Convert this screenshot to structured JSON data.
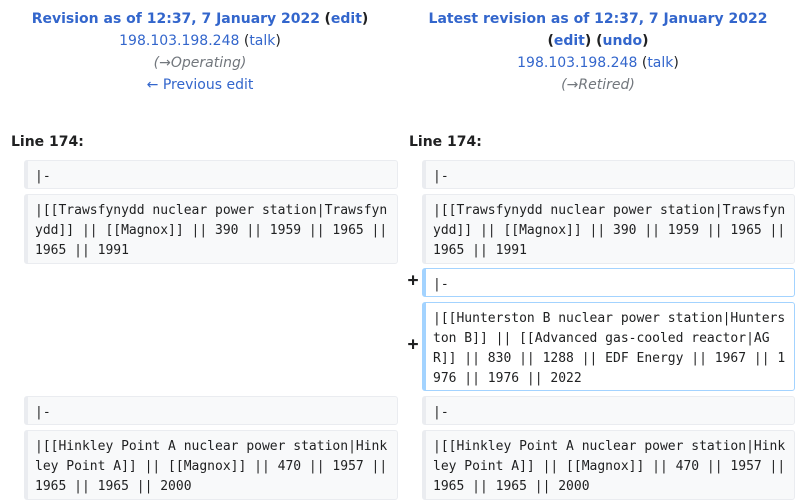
{
  "left": {
    "revision_label": "Revision as of 12:37, 7 January 2022",
    "edit_label": "edit",
    "user": "198.103.198.248",
    "talk_label": "talk",
    "summary_arrow": "→",
    "summary_text": "Operating",
    "prev_edit_label": "← Previous edit",
    "line_label": "Line 174:"
  },
  "right": {
    "revision_label": "Latest revision as of 12:37, 7 January 2022",
    "edit_label": "edit",
    "undo_label": "undo",
    "user": "198.103.198.248",
    "talk_label": "talk",
    "summary_arrow": "→",
    "summary_text": "Retired",
    "line_label": "Line 174:"
  },
  "diff": {
    "marker_added": "+",
    "row1": "|-",
    "row2": "|[[Trawsfynydd nuclear power station|Trawsfynydd]] || [[Magnox]] || 390 || 1959 || 1965 || 1965 || 1991",
    "added1": "|-",
    "added2": "|[[Hunterston B nuclear power station|Hunterston B]] || [[Advanced gas-cooled reactor|AGR]] || 830 || 1288 || EDF Energy || 1967 || 1976 || 1976 || 2022",
    "row3": "|-",
    "row4": "|[[Hinkley Point A nuclear power station|Hinkley Point A]] || [[Magnox]] || 470 || 1957 || 1965 || 1965 || 2000"
  }
}
